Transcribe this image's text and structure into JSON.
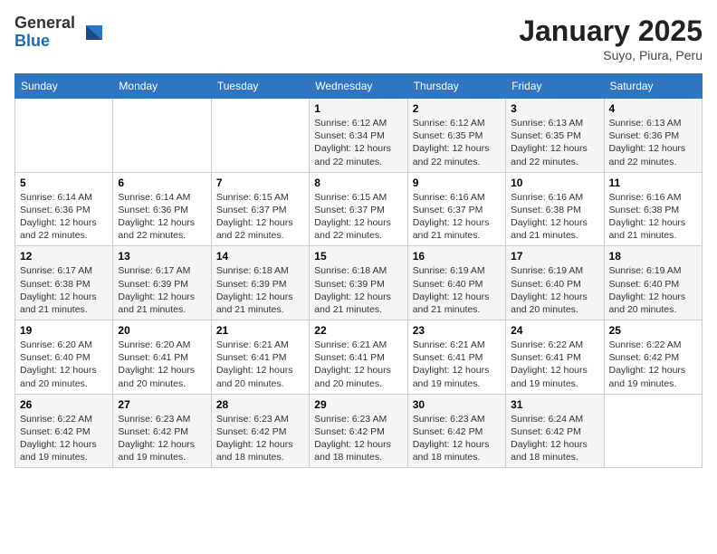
{
  "header": {
    "logo_general": "General",
    "logo_blue": "Blue",
    "title": "January 2025",
    "subtitle": "Suyo, Piura, Peru"
  },
  "weekdays": [
    "Sunday",
    "Monday",
    "Tuesday",
    "Wednesday",
    "Thursday",
    "Friday",
    "Saturday"
  ],
  "weeks": [
    [
      {
        "day": "",
        "info": ""
      },
      {
        "day": "",
        "info": ""
      },
      {
        "day": "",
        "info": ""
      },
      {
        "day": "1",
        "info": "Sunrise: 6:12 AM\nSunset: 6:34 PM\nDaylight: 12 hours\nand 22 minutes."
      },
      {
        "day": "2",
        "info": "Sunrise: 6:12 AM\nSunset: 6:35 PM\nDaylight: 12 hours\nand 22 minutes."
      },
      {
        "day": "3",
        "info": "Sunrise: 6:13 AM\nSunset: 6:35 PM\nDaylight: 12 hours\nand 22 minutes."
      },
      {
        "day": "4",
        "info": "Sunrise: 6:13 AM\nSunset: 6:36 PM\nDaylight: 12 hours\nand 22 minutes."
      }
    ],
    [
      {
        "day": "5",
        "info": "Sunrise: 6:14 AM\nSunset: 6:36 PM\nDaylight: 12 hours\nand 22 minutes."
      },
      {
        "day": "6",
        "info": "Sunrise: 6:14 AM\nSunset: 6:36 PM\nDaylight: 12 hours\nand 22 minutes."
      },
      {
        "day": "7",
        "info": "Sunrise: 6:15 AM\nSunset: 6:37 PM\nDaylight: 12 hours\nand 22 minutes."
      },
      {
        "day": "8",
        "info": "Sunrise: 6:15 AM\nSunset: 6:37 PM\nDaylight: 12 hours\nand 22 minutes."
      },
      {
        "day": "9",
        "info": "Sunrise: 6:16 AM\nSunset: 6:37 PM\nDaylight: 12 hours\nand 21 minutes."
      },
      {
        "day": "10",
        "info": "Sunrise: 6:16 AM\nSunset: 6:38 PM\nDaylight: 12 hours\nand 21 minutes."
      },
      {
        "day": "11",
        "info": "Sunrise: 6:16 AM\nSunset: 6:38 PM\nDaylight: 12 hours\nand 21 minutes."
      }
    ],
    [
      {
        "day": "12",
        "info": "Sunrise: 6:17 AM\nSunset: 6:38 PM\nDaylight: 12 hours\nand 21 minutes."
      },
      {
        "day": "13",
        "info": "Sunrise: 6:17 AM\nSunset: 6:39 PM\nDaylight: 12 hours\nand 21 minutes."
      },
      {
        "day": "14",
        "info": "Sunrise: 6:18 AM\nSunset: 6:39 PM\nDaylight: 12 hours\nand 21 minutes."
      },
      {
        "day": "15",
        "info": "Sunrise: 6:18 AM\nSunset: 6:39 PM\nDaylight: 12 hours\nand 21 minutes."
      },
      {
        "day": "16",
        "info": "Sunrise: 6:19 AM\nSunset: 6:40 PM\nDaylight: 12 hours\nand 21 minutes."
      },
      {
        "day": "17",
        "info": "Sunrise: 6:19 AM\nSunset: 6:40 PM\nDaylight: 12 hours\nand 20 minutes."
      },
      {
        "day": "18",
        "info": "Sunrise: 6:19 AM\nSunset: 6:40 PM\nDaylight: 12 hours\nand 20 minutes."
      }
    ],
    [
      {
        "day": "19",
        "info": "Sunrise: 6:20 AM\nSunset: 6:40 PM\nDaylight: 12 hours\nand 20 minutes."
      },
      {
        "day": "20",
        "info": "Sunrise: 6:20 AM\nSunset: 6:41 PM\nDaylight: 12 hours\nand 20 minutes."
      },
      {
        "day": "21",
        "info": "Sunrise: 6:21 AM\nSunset: 6:41 PM\nDaylight: 12 hours\nand 20 minutes."
      },
      {
        "day": "22",
        "info": "Sunrise: 6:21 AM\nSunset: 6:41 PM\nDaylight: 12 hours\nand 20 minutes."
      },
      {
        "day": "23",
        "info": "Sunrise: 6:21 AM\nSunset: 6:41 PM\nDaylight: 12 hours\nand 19 minutes."
      },
      {
        "day": "24",
        "info": "Sunrise: 6:22 AM\nSunset: 6:41 PM\nDaylight: 12 hours\nand 19 minutes."
      },
      {
        "day": "25",
        "info": "Sunrise: 6:22 AM\nSunset: 6:42 PM\nDaylight: 12 hours\nand 19 minutes."
      }
    ],
    [
      {
        "day": "26",
        "info": "Sunrise: 6:22 AM\nSunset: 6:42 PM\nDaylight: 12 hours\nand 19 minutes."
      },
      {
        "day": "27",
        "info": "Sunrise: 6:23 AM\nSunset: 6:42 PM\nDaylight: 12 hours\nand 19 minutes."
      },
      {
        "day": "28",
        "info": "Sunrise: 6:23 AM\nSunset: 6:42 PM\nDaylight: 12 hours\nand 18 minutes."
      },
      {
        "day": "29",
        "info": "Sunrise: 6:23 AM\nSunset: 6:42 PM\nDaylight: 12 hours\nand 18 minutes."
      },
      {
        "day": "30",
        "info": "Sunrise: 6:23 AM\nSunset: 6:42 PM\nDaylight: 12 hours\nand 18 minutes."
      },
      {
        "day": "31",
        "info": "Sunrise: 6:24 AM\nSunset: 6:42 PM\nDaylight: 12 hours\nand 18 minutes."
      },
      {
        "day": "",
        "info": ""
      }
    ]
  ]
}
